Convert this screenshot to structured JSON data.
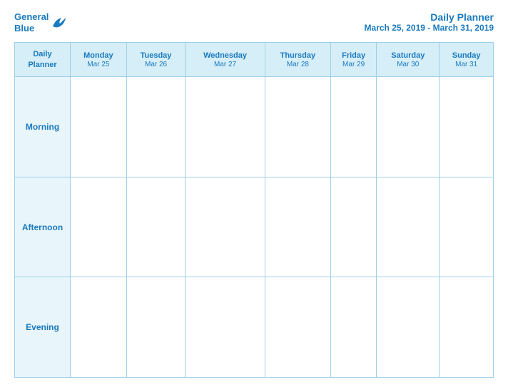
{
  "logo": {
    "text_general": "General",
    "text_blue": "Blue"
  },
  "title": {
    "main": "Daily Planner",
    "sub": "March 25, 2019 - March 31, 2019"
  },
  "table": {
    "header": {
      "label_line1": "Daily",
      "label_line2": "Planner",
      "columns": [
        {
          "day": "Monday",
          "date": "Mar 25"
        },
        {
          "day": "Tuesday",
          "date": "Mar 26"
        },
        {
          "day": "Wednesday",
          "date": "Mar 27"
        },
        {
          "day": "Thursday",
          "date": "Mar 28"
        },
        {
          "day": "Friday",
          "date": "Mar 29"
        },
        {
          "day": "Saturday",
          "date": "Mar 30"
        },
        {
          "day": "Sunday",
          "date": "Mar 31"
        }
      ]
    },
    "rows": [
      {
        "label": "Morning"
      },
      {
        "label": "Afternoon"
      },
      {
        "label": "Evening"
      }
    ]
  }
}
